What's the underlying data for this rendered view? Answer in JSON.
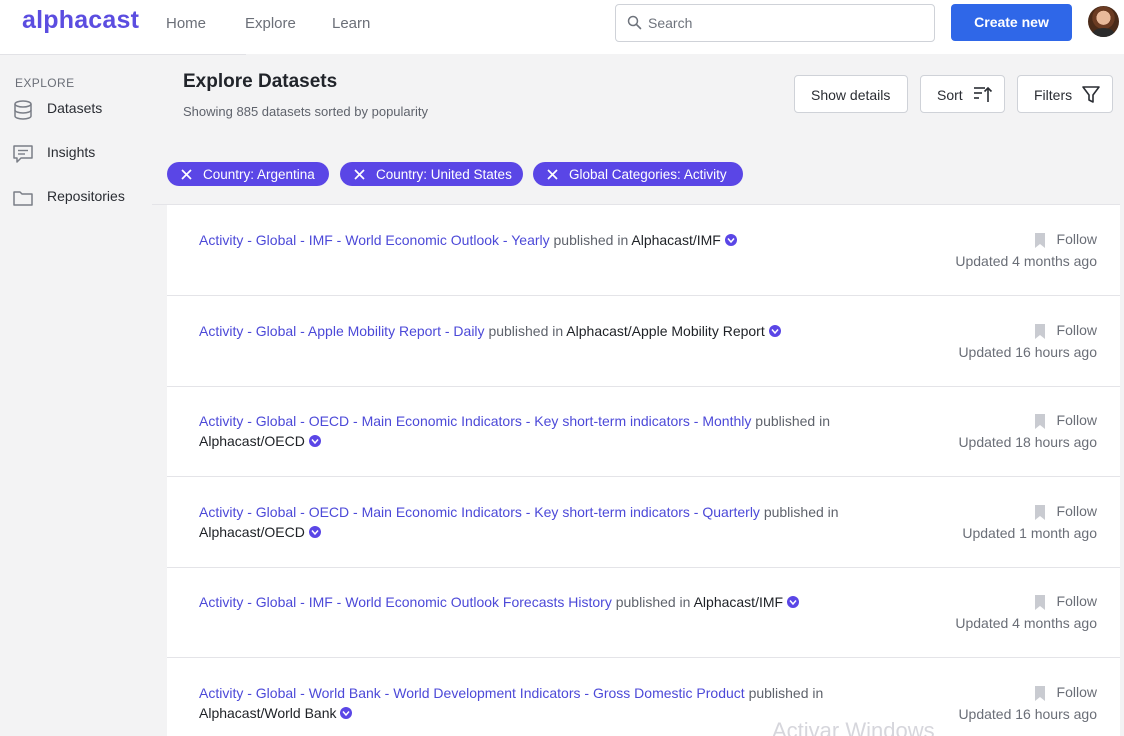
{
  "brand": {
    "logo_text": "alphacast",
    "accent": "#5b4de0",
    "primary_button": "#2f67e8",
    "chip_color": "#5a46e6",
    "link_color": "#4c49d8"
  },
  "topnav": {
    "links": [
      "Home",
      "Explore",
      "Learn"
    ],
    "search_placeholder": "Search",
    "search_icon": "search-icon",
    "create_label": "Create new"
  },
  "sidebar": {
    "heading": "EXPLORE",
    "items": [
      {
        "label": "Datasets",
        "icon": "database-icon"
      },
      {
        "label": "Insights",
        "icon": "chat-icon"
      },
      {
        "label": "Repositories",
        "icon": "folder-icon"
      }
    ]
  },
  "header": {
    "title": "Explore Datasets",
    "subtitle": "Showing 885 datasets sorted by popularity",
    "show_details": "Show details",
    "sort": "Sort",
    "filters": "Filters"
  },
  "chips": [
    "Country: Argentina",
    "Country: United States",
    "Global Categories: Activity"
  ],
  "results": [
    {
      "dataset": "Activity - Global - IMF - World Economic Outlook - Yearly",
      "published_in": "published in",
      "repo": "Alphacast/IMF",
      "follow": "Follow",
      "updated": "Updated 4 months ago"
    },
    {
      "dataset": "Activity - Global - Apple Mobility Report - Daily",
      "published_in": "published in",
      "repo": "Alphacast/Apple Mobility Report",
      "follow": "Follow",
      "updated": "Updated 16 hours ago"
    },
    {
      "dataset": "Activity - Global - OECD - Main Economic Indicators - Key short-term indicators - Monthly",
      "published_in": "published in",
      "repo": "Alphacast/OECD",
      "follow": "Follow",
      "updated": "Updated 18 hours ago"
    },
    {
      "dataset": "Activity - Global - OECD - Main Economic Indicators - Key short-term indicators - Quarterly",
      "published_in": "published in",
      "repo": "Alphacast/OECD",
      "follow": "Follow",
      "updated": "Updated 1 month ago"
    },
    {
      "dataset": "Activity - Global - IMF - World Economic Outlook Forecasts History",
      "published_in": "published in",
      "repo": "Alphacast/IMF",
      "follow": "Follow",
      "updated": "Updated 4 months ago"
    },
    {
      "dataset": "Activity - Global - World Bank - World Development Indicators - Gross Domestic Product",
      "published_in": "published in",
      "repo": "Alphacast/World Bank",
      "follow": "Follow",
      "updated": "Updated 16 hours ago"
    }
  ],
  "watermark": "Activar Windows"
}
